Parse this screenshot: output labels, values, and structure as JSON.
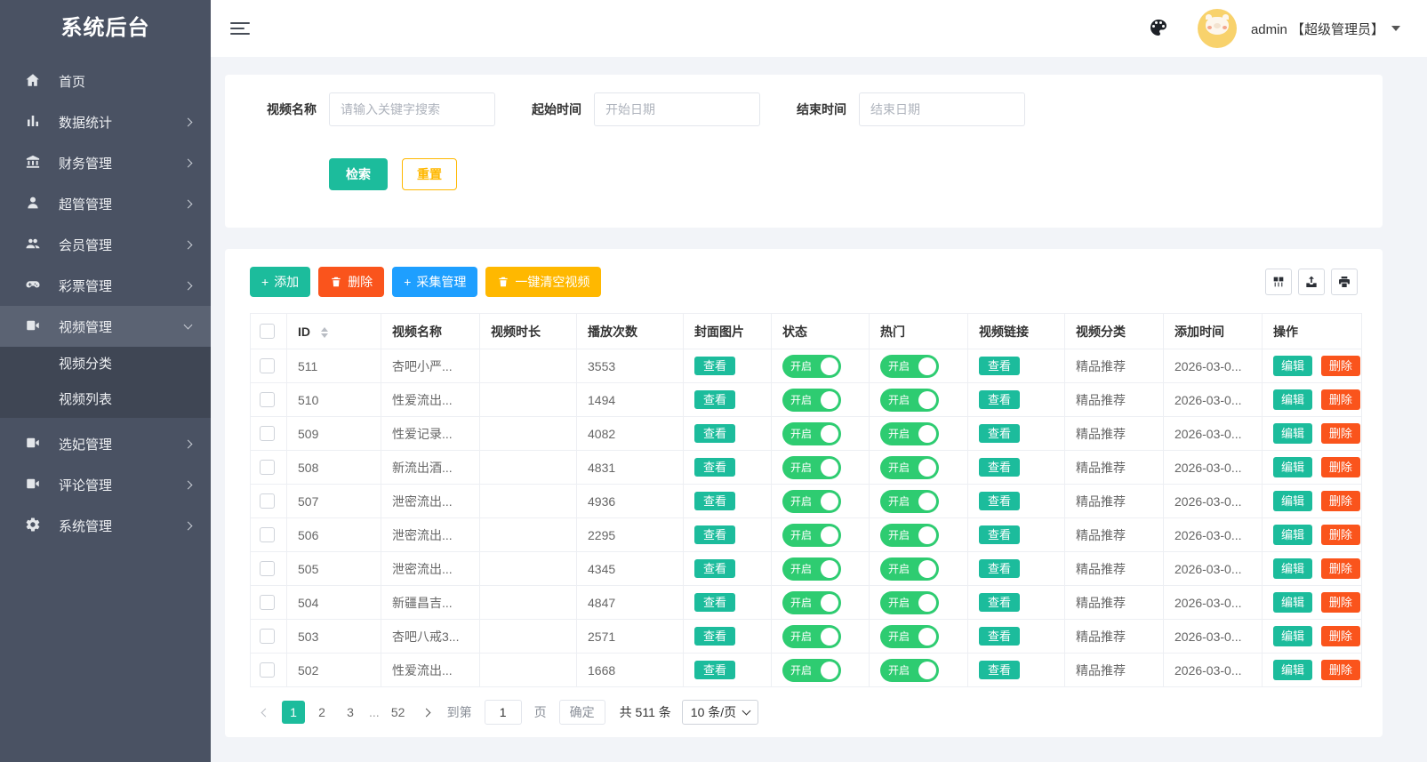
{
  "app": {
    "title": "系统后台"
  },
  "topbar": {
    "admin_label": "admin 【超级管理员】"
  },
  "icons": {
    "plus": "+"
  },
  "sidebar": {
    "items": [
      {
        "label": "首页",
        "icon": "home-icon",
        "arrow": "none"
      },
      {
        "label": "数据统计",
        "icon": "bar-chart-icon",
        "arrow": "right"
      },
      {
        "label": "财务管理",
        "icon": "bank-icon",
        "arrow": "right"
      },
      {
        "label": "超管管理",
        "icon": "user-icon",
        "arrow": "right"
      },
      {
        "label": "会员管理",
        "icon": "users-icon",
        "arrow": "right"
      },
      {
        "label": "彩票管理",
        "icon": "gamepad-icon",
        "arrow": "right"
      },
      {
        "label": "视频管理",
        "icon": "video-camera-icon",
        "arrow": "down",
        "active": true,
        "children": [
          "视频分类",
          "视频列表"
        ]
      },
      {
        "label": "选妃管理",
        "icon": "video-camera-icon",
        "arrow": "right"
      },
      {
        "label": "评论管理",
        "icon": "video-camera-icon",
        "arrow": "right"
      },
      {
        "label": "系统管理",
        "icon": "gear-icon",
        "arrow": "right"
      }
    ]
  },
  "search": {
    "fields": [
      {
        "label": "视频名称",
        "placeholder": "请输入关键字搜索"
      },
      {
        "label": "起始时间",
        "placeholder": "开始日期"
      },
      {
        "label": "结束时间",
        "placeholder": "结束日期"
      }
    ],
    "search_label": "检索",
    "reset_label": "重置"
  },
  "toolbar": {
    "add_label": "添加",
    "delete_label": "删除",
    "collect_label": "采集管理",
    "clear_label": "一键清空视频"
  },
  "table": {
    "columns": [
      "ID",
      "视频名称",
      "视频时长",
      "播放次数",
      "封面图片",
      "状态",
      "热门",
      "视频链接",
      "视频分类",
      "添加时间",
      "操作"
    ],
    "badges": {
      "view": "查看",
      "on": "开启",
      "edit": "编辑",
      "delete": "删除"
    },
    "rows": [
      {
        "id": "511",
        "name": "杏吧小严...",
        "duration": "",
        "plays": "3553",
        "category": "精品推荐",
        "added": "2026-03-0..."
      },
      {
        "id": "510",
        "name": "性爱流出...",
        "duration": "",
        "plays": "1494",
        "category": "精品推荐",
        "added": "2026-03-0..."
      },
      {
        "id": "509",
        "name": "性爱记录...",
        "duration": "",
        "plays": "4082",
        "category": "精品推荐",
        "added": "2026-03-0..."
      },
      {
        "id": "508",
        "name": "新流出酒...",
        "duration": "",
        "plays": "4831",
        "category": "精品推荐",
        "added": "2026-03-0..."
      },
      {
        "id": "507",
        "name": "泄密流出...",
        "duration": "",
        "plays": "4936",
        "category": "精品推荐",
        "added": "2026-03-0..."
      },
      {
        "id": "506",
        "name": "泄密流出...",
        "duration": "",
        "plays": "2295",
        "category": "精品推荐",
        "added": "2026-03-0..."
      },
      {
        "id": "505",
        "name": "泄密流出...",
        "duration": "",
        "plays": "4345",
        "category": "精品推荐",
        "added": "2026-03-0..."
      },
      {
        "id": "504",
        "name": "新疆昌吉...",
        "duration": "",
        "plays": "4847",
        "category": "精品推荐",
        "added": "2026-03-0..."
      },
      {
        "id": "503",
        "name": "杏吧八戒3...",
        "duration": "",
        "plays": "2571",
        "category": "精品推荐",
        "added": "2026-03-0..."
      },
      {
        "id": "502",
        "name": "性爱流出...",
        "duration": "",
        "plays": "1668",
        "category": "精品推荐",
        "added": "2026-03-0..."
      }
    ]
  },
  "pagination": {
    "pages": [
      "1",
      "2",
      "3",
      "...",
      "52"
    ],
    "active_page": "1",
    "goto_prefix": "到第",
    "goto_value": "1",
    "goto_suffix": "页",
    "confirm_label": "确定",
    "total_label": "共 511 条",
    "page_size_label": "10 条/页"
  },
  "colors": {
    "teal": "#1cbc9c",
    "toggle_green": "#2ecc71",
    "red": "#fa541c",
    "blue": "#1e9fff",
    "yellow": "#ffb800",
    "sidebar_bg": "#4a5263"
  }
}
